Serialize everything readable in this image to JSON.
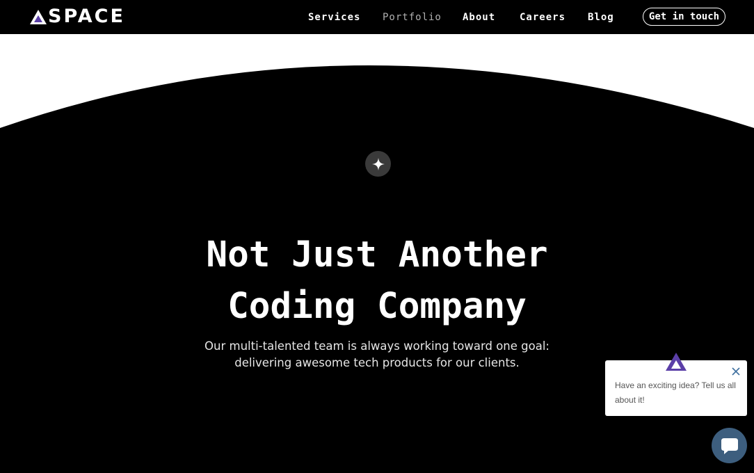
{
  "brand": {
    "name": "SPACE",
    "accent": "#5b3fa8"
  },
  "nav": {
    "items": [
      {
        "label": "Services",
        "active": false
      },
      {
        "label": "Portfolio",
        "active": true
      },
      {
        "label": "About",
        "active": false
      },
      {
        "label": "Careers",
        "active": false
      },
      {
        "label": "Blog",
        "active": false
      }
    ],
    "cta_label": "Get in touch"
  },
  "hero": {
    "badge_icon": "sparkle-icon",
    "title_line1": "Not Just Another",
    "title_line2": "Coding Company",
    "subtitle_line1": "Our multi-talented team is always working toward one goal:",
    "subtitle_line2": "delivering awesome tech products for our clients."
  },
  "chat": {
    "message": "Have an exciting idea? Tell us all about it!",
    "close_icon": "close-icon",
    "button_icon": "chat-bubble-icon",
    "button_color": "#3d5e7e"
  }
}
